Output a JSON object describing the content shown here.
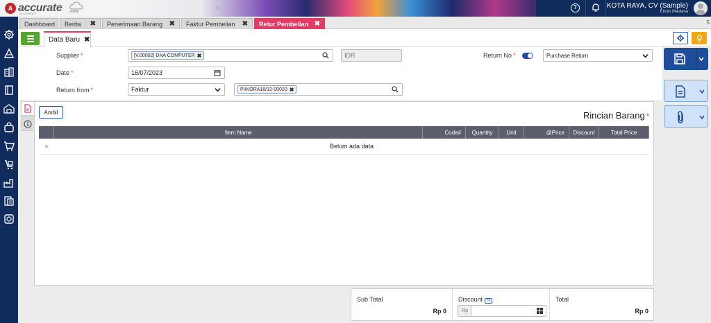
{
  "app": {
    "logo_text": "accurate",
    "logo_online": "online",
    "logo_sub": "by CPSSOFT",
    "company": "KOTA RAYA, CV (Sample)",
    "user": "Ervan Maulana"
  },
  "tabs": [
    {
      "label": "Dashboard",
      "closable": false
    },
    {
      "label": "Berita",
      "closable": true
    },
    {
      "label": "Penerimaan Barang",
      "closable": true
    },
    {
      "label": "Faktur Pembelian",
      "closable": true
    },
    {
      "label": "Retur Pembelian",
      "closable": true,
      "active": true
    }
  ],
  "tab_count": "5",
  "close_glyph": "✖",
  "doc_tab": {
    "label": "Data Baru"
  },
  "form": {
    "supplier_label": "Supplier",
    "supplier_value": "[V.00002] DNA COMPUTER",
    "currency": "IDR",
    "date_label": "Date",
    "date_value": "16/07/2023",
    "return_from_label": "Return from",
    "return_from_value": "Faktur",
    "invoice_value": "PI/KORA18/12-00020",
    "return_no_label": "Return No",
    "return_type_value": "Purchase Return",
    "required_mark": "*"
  },
  "detail": {
    "ambil_label": "Ambil",
    "title": "Rincian Barang",
    "columns": [
      "Item Name",
      "Code#",
      "Quantity",
      "Unit",
      "@Price",
      "Discount",
      "Total Price"
    ],
    "row_handle": "≡",
    "empty_text": "Belum ada data"
  },
  "totals": {
    "subtotal_label": "Sub Total",
    "subtotal_value": "Rp 0",
    "discount_label": "Discount",
    "discount_pct": "%",
    "discount_prefix": "Rp",
    "total_label": "Total",
    "total_value": "Rp 0"
  },
  "colors": {
    "accent": "#e23c64",
    "navy": "#0f2c5c",
    "primary": "#1f4d9c",
    "green": "#55a630",
    "orange": "#f3a712"
  },
  "sidebar_icons": [
    "gear-icon",
    "buildings-icon",
    "bank-icon",
    "ledger-icon",
    "warehouse-icon",
    "bag-icon",
    "cart-icon",
    "purchase-cart-icon",
    "factory-icon",
    "report-icon",
    "dashboard-icon"
  ]
}
